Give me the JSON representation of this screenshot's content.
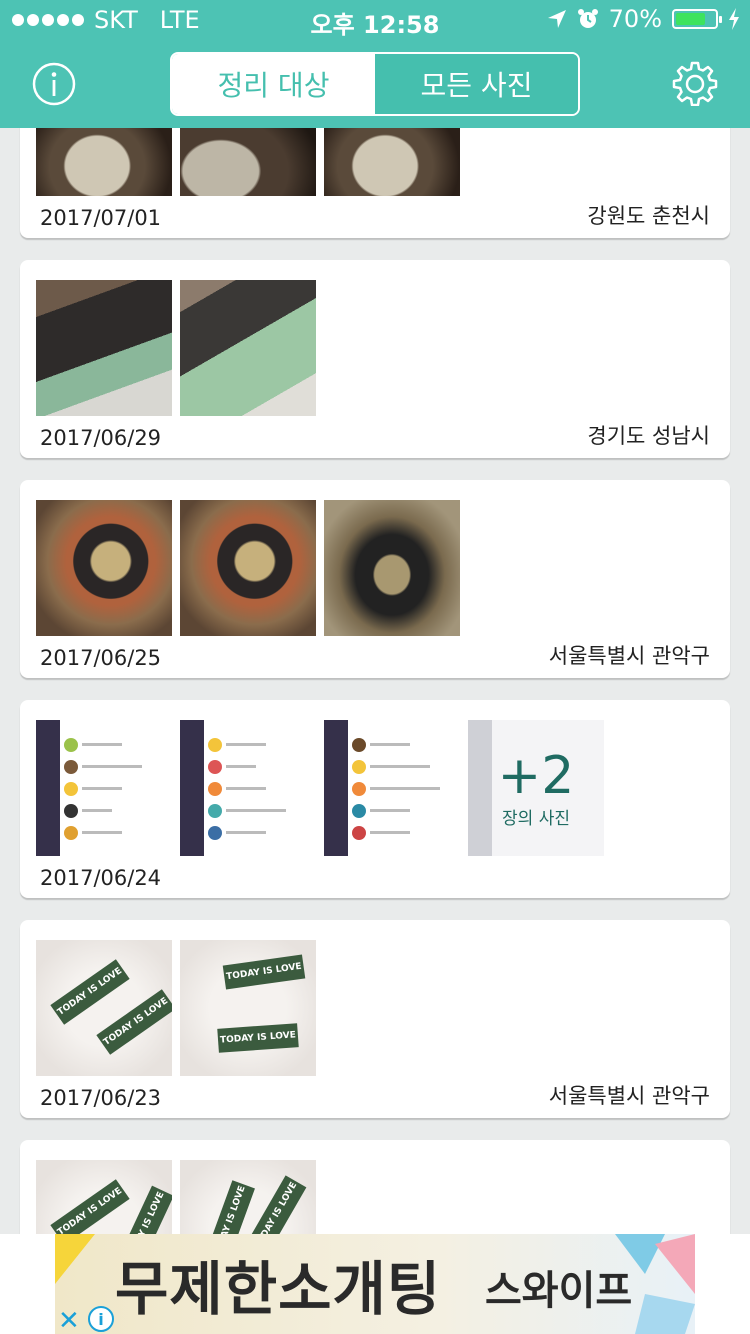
{
  "status_bar": {
    "carrier": "SKT",
    "network": "LTE",
    "time": "오후 12:58",
    "battery": "70%",
    "battery_level": 0.7
  },
  "header": {
    "tabs": [
      {
        "label": "정리 대상",
        "selected": true
      },
      {
        "label": "모든 사진",
        "selected": false
      }
    ],
    "info_icon": "info-icon",
    "settings_icon": "gear-icon",
    "accent_color": "#4dc3b4"
  },
  "groups": [
    {
      "date": "2017/07/01",
      "location": "강원도 춘천시",
      "photo_count": 3
    },
    {
      "date": "2017/06/29",
      "location": "경기도 성남시",
      "photo_count": 2
    },
    {
      "date": "2017/06/25",
      "location": "서울특별시 관악구",
      "photo_count": 3
    },
    {
      "date": "2017/06/24",
      "location": "",
      "photo_count": 4,
      "more": {
        "count": "+2",
        "caption": "장의 사진"
      }
    },
    {
      "date": "2017/06/23",
      "location": "서울특별시 관악구",
      "photo_count": 2
    },
    {
      "date": "",
      "location": "",
      "photo_count": 2
    }
  ],
  "photo_text": {
    "case_tag": "TODAY IS LOVE"
  },
  "ad": {
    "headline": "무제한소개팅",
    "brand": "스와이프",
    "close_icon": "close-icon",
    "info_icon": "ad-info-icon"
  }
}
